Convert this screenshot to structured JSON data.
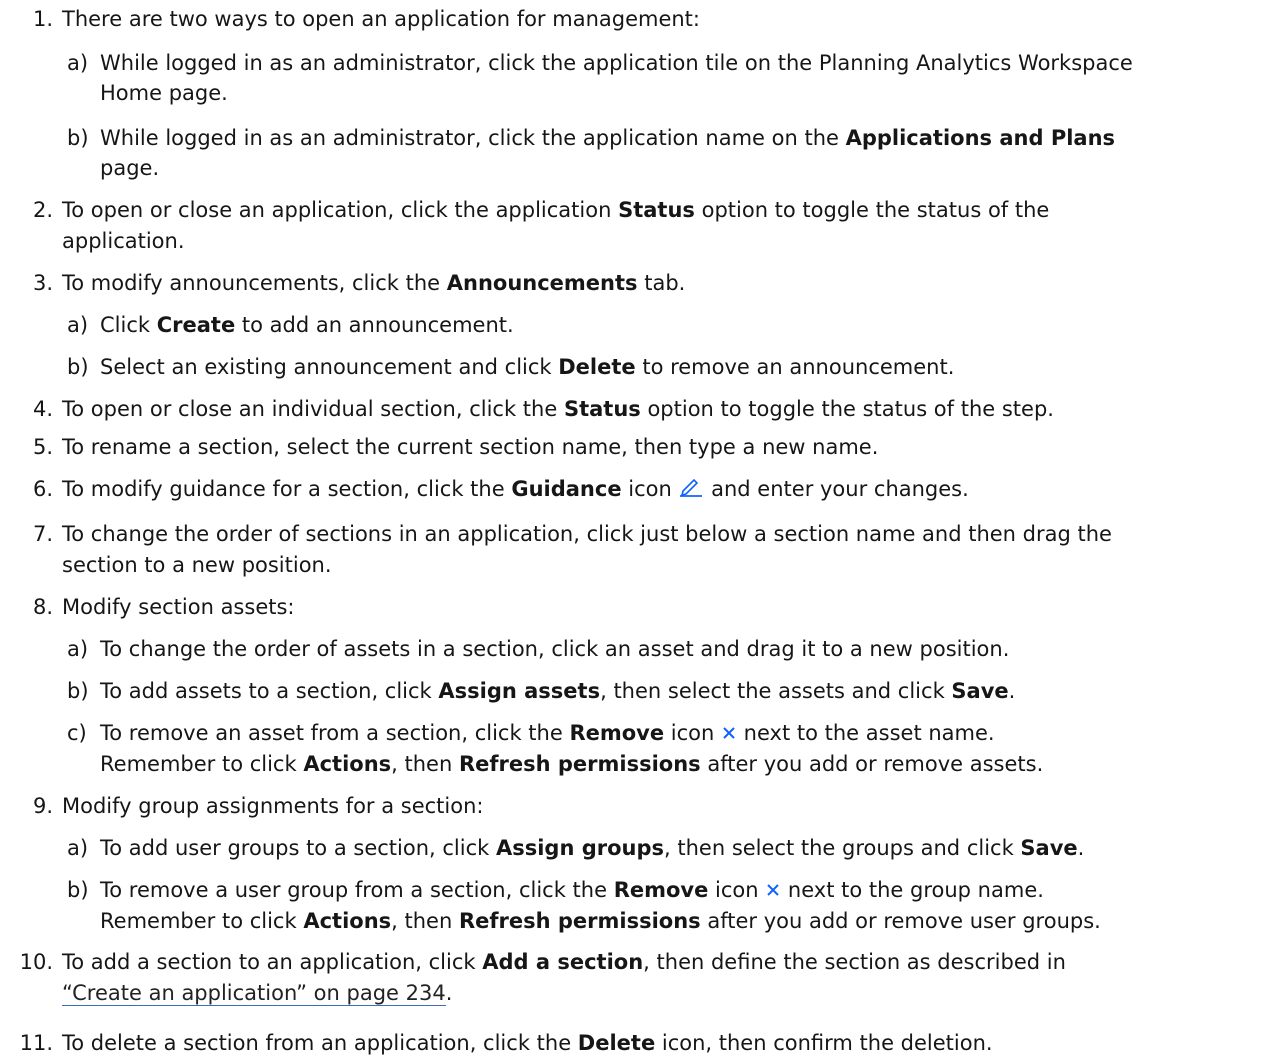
{
  "steps": {
    "s1": {
      "num": "1.",
      "text": "There are two ways to open an application for management:"
    },
    "s1a": {
      "letter": "a)",
      "text": "While logged in as an administrator, click the application tile on the Planning Analytics Workspace",
      "cont": "Home page."
    },
    "s1b": {
      "letter": "b)",
      "pre": "While logged in as an administrator, click the application name on the ",
      "bold": "Applications and Plans",
      "cont": "page."
    },
    "s2": {
      "num": "2.",
      "pre": "To open or close an application, click the application ",
      "bold": "Status",
      "post": " option to toggle the status of the",
      "cont": "application."
    },
    "s3": {
      "num": "3.",
      "pre": "To modify announcements, click the ",
      "bold": "Announcements",
      "post": " tab."
    },
    "s3a": {
      "letter": "a)",
      "pre": "Click ",
      "bold": "Create",
      "post": " to add an announcement."
    },
    "s3b": {
      "letter": "b)",
      "pre": "Select an existing announcement and click ",
      "bold": "Delete",
      "post": " to remove an announcement."
    },
    "s4": {
      "num": "4.",
      "pre": "To open or close an individual section, click the ",
      "bold": "Status",
      "post": " option to toggle the status of the step."
    },
    "s5": {
      "num": "5.",
      "text": "To rename a section, select the current section name, then type a new name."
    },
    "s6": {
      "num": "6.",
      "pre": "To modify guidance for a section, click the ",
      "bold": "Guidance",
      "mid": " icon ",
      "post": " and enter your changes."
    },
    "s7": {
      "num": "7.",
      "text": "To change the order of sections in an application, click just below a section name and then drag the",
      "cont": "section to a new position."
    },
    "s8": {
      "num": "8.",
      "text": "Modify section assets:"
    },
    "s8a": {
      "letter": "a)",
      "text": "To change the order of assets in a section, click an asset and drag it to a new position."
    },
    "s8b": {
      "letter": "b)",
      "pre": "To add assets to a section, click ",
      "bold": "Assign assets",
      "mid": ", then select the assets and click ",
      "bold2": "Save",
      "post": "."
    },
    "s8c": {
      "letter": "c)",
      "pre": "To remove an asset from a section, click the ",
      "bold": "Remove",
      "mid": " icon ",
      "post": " next to the asset name."
    },
    "s8note": {
      "pre": "Remember to click ",
      "bold": "Actions",
      "mid": ", then ",
      "bold2": "Refresh permissions",
      "post": " after you add or remove assets."
    },
    "s9": {
      "num": "9.",
      "text": "Modify group assignments for a section:"
    },
    "s9a": {
      "letter": "a)",
      "pre": "To add user groups to a section, click ",
      "bold": "Assign groups",
      "mid": ", then select the groups and click ",
      "bold2": "Save",
      "post": "."
    },
    "s9b": {
      "letter": "b)",
      "pre": "To remove a user group from a section, click the ",
      "bold": "Remove",
      "mid": " icon ",
      "post": " next to the group name."
    },
    "s9note": {
      "pre": "Remember to click ",
      "bold": "Actions",
      "mid": ", then ",
      "bold2": "Refresh permissions",
      "post": " after you add or remove user groups."
    },
    "s10": {
      "num": "10.",
      "pre": "To add a section to an application, click ",
      "bold": "Add a section",
      "post": ", then define the section as described in",
      "link": "“Create an application” on page 234",
      "end": "."
    },
    "s11": {
      "num": "11.",
      "pre": "To delete a section from an application, click the ",
      "bold": "Delete",
      "post": " icon, then confirm the deletion."
    }
  },
  "icons": {
    "guidance": "pencil-icon",
    "remove": "close-x-icon",
    "accent": "#0f62fe"
  }
}
